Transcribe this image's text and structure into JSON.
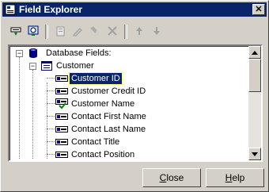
{
  "window": {
    "title": "Field Explorer",
    "close_glyph": "✕"
  },
  "toolbar": {
    "icons": [
      "insert-field-icon",
      "browse-field-icon",
      "new-field-icon",
      "edit-field-icon",
      "rename-field-icon",
      "delete-field-icon",
      "move-up-icon",
      "move-down-icon"
    ]
  },
  "tree": {
    "root_label": "Database Fields:",
    "table_label": "Customer",
    "fields": [
      {
        "label": "Customer ID",
        "selected": true
      },
      {
        "label": "Customer Credit ID",
        "selected": false
      },
      {
        "label": "Customer Name",
        "selected": false,
        "used": true
      },
      {
        "label": "Contact First Name",
        "selected": false
      },
      {
        "label": "Contact Last Name",
        "selected": false
      },
      {
        "label": "Contact Title",
        "selected": false
      },
      {
        "label": "Contact Position",
        "selected": false
      }
    ]
  },
  "buttons": {
    "close_label": "Close",
    "close_mnemonic": "C",
    "close_rest": "lose",
    "help_label": "Help",
    "help_mnemonic": "H",
    "help_rest": "elp"
  }
}
